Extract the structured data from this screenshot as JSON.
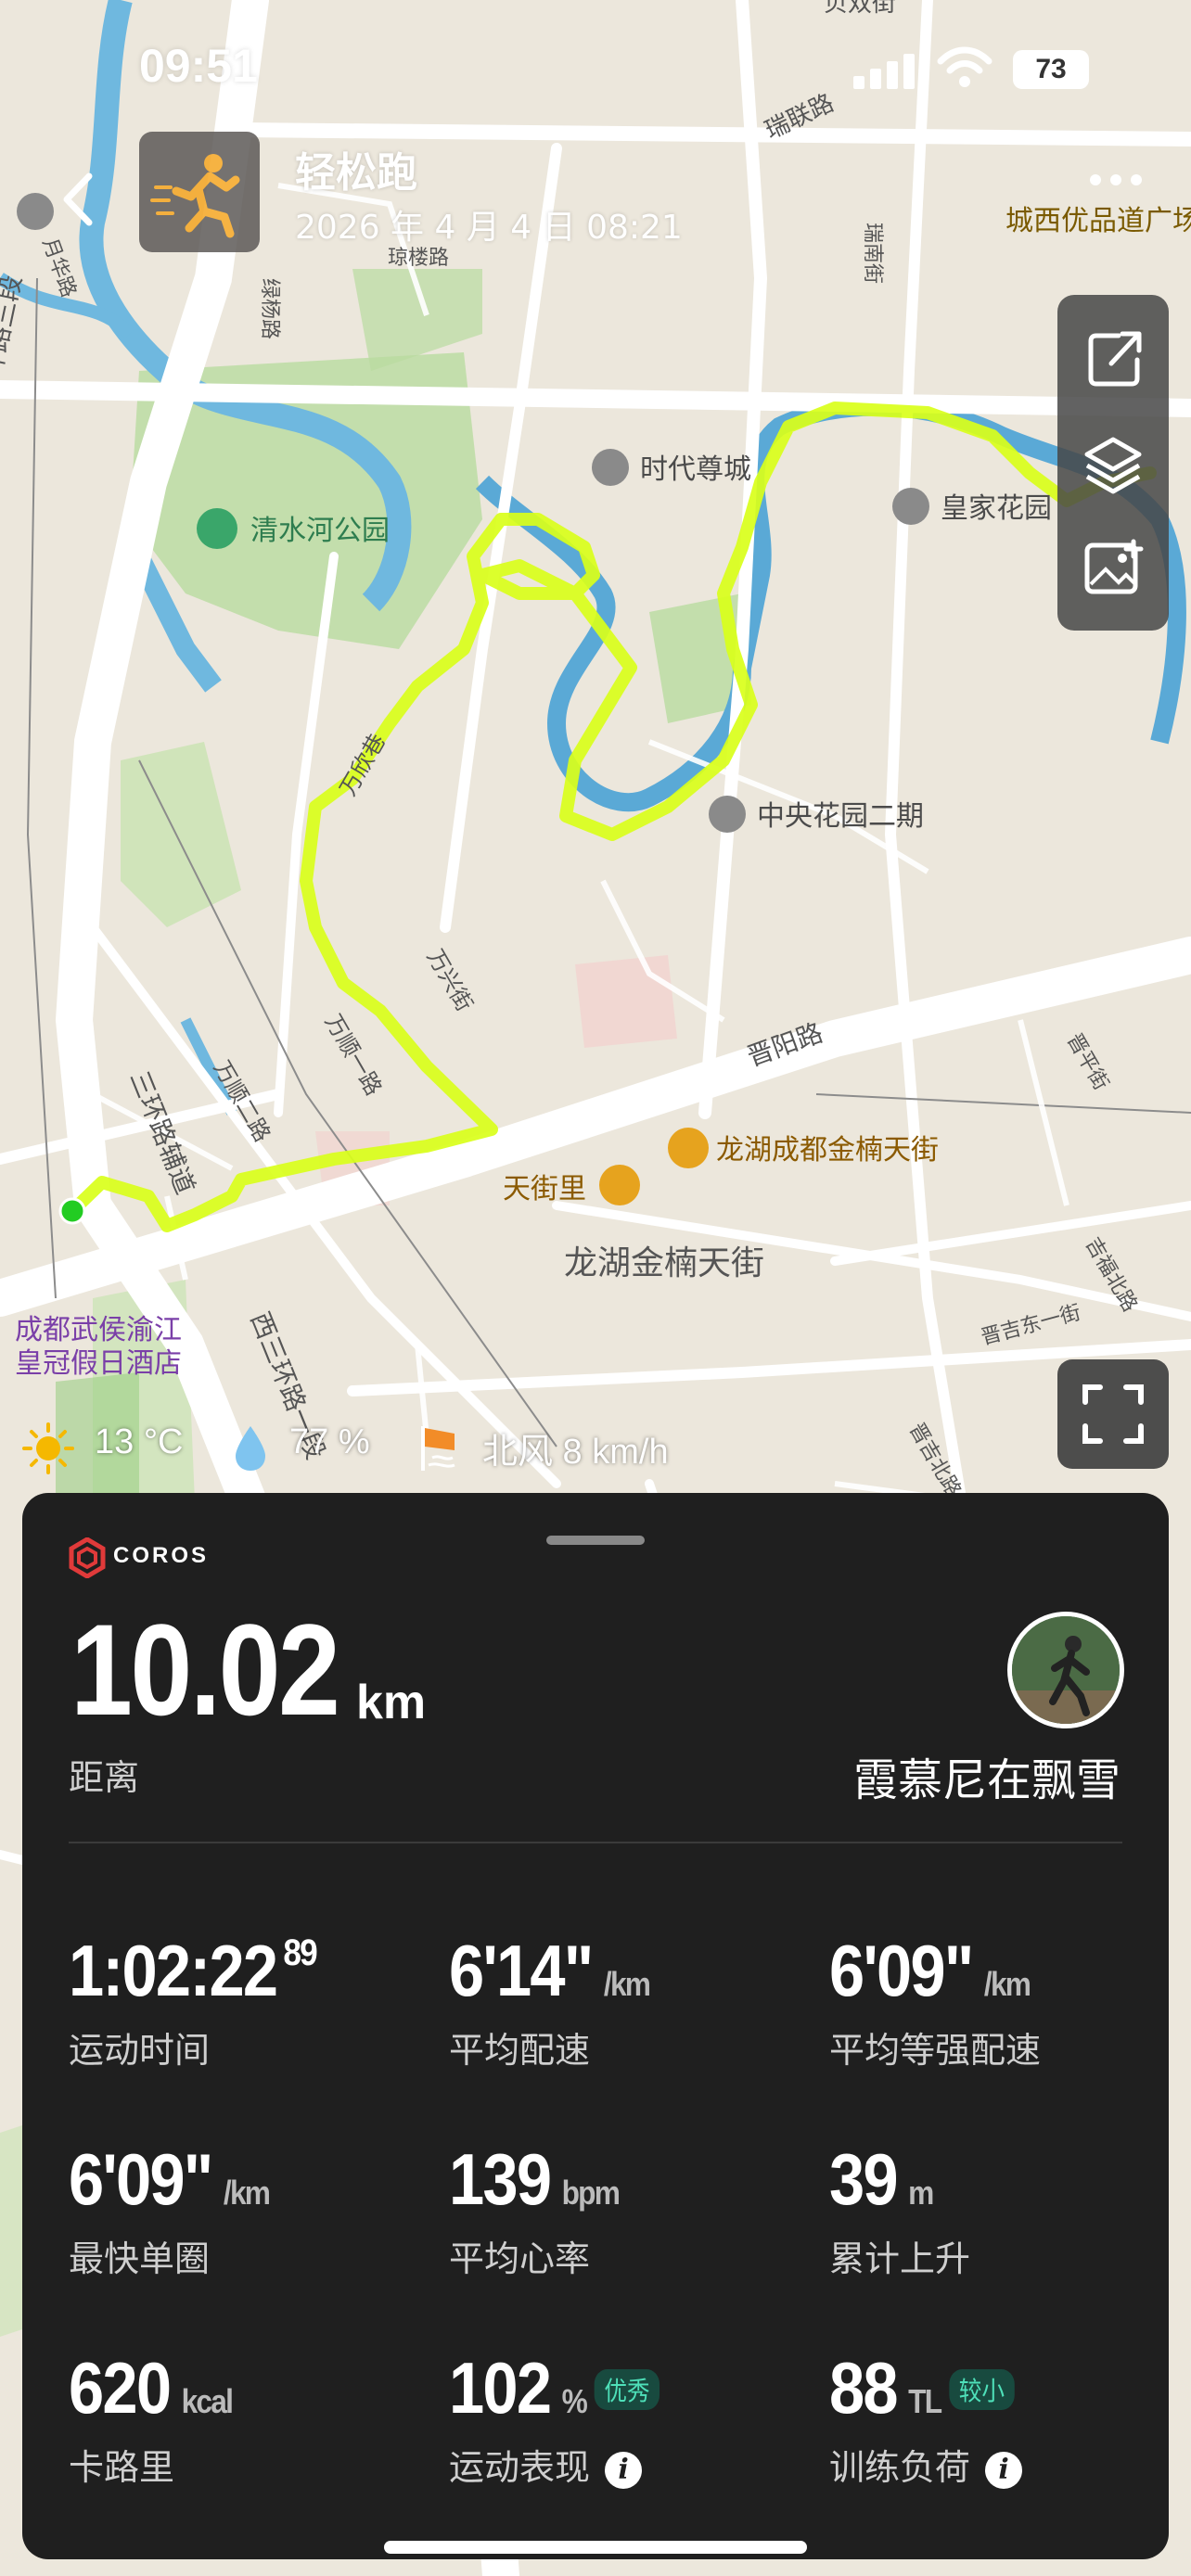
{
  "status_bar": {
    "time": "09:51",
    "battery": "73"
  },
  "header": {
    "title": "轻松跑",
    "date": "2026 年 4 月 4 日 08:21"
  },
  "map_labels": {
    "roads": [
      "瑞联路",
      "西三环路三段",
      "三环路辅道",
      "西三环路一段",
      "晋阳路",
      "万顺一路",
      "万顺二路",
      "万欣巷",
      "万兴街",
      "晋吉东一街",
      "吉福北路",
      "晋吉北路",
      "晋平街",
      "琼楼路",
      "绿杨路",
      "瑞南街",
      "月华路",
      "三环路辅道",
      "交",
      "武侯",
      "贝双街"
    ],
    "pois": [
      "清水河公园",
      "时代尊城",
      "皇家花园",
      "中央花园二期",
      "龙湖成都金楠天街",
      "天街里",
      "龙湖金楠天街",
      "成都武侯渝江皇冠假日酒店",
      "城西优品道广场"
    ]
  },
  "weather": {
    "temperature": "13 °C",
    "humidity": "77 %",
    "wind": "北风 8 km/h"
  },
  "summary": {
    "brand": "COROS",
    "distance_value": "10.02",
    "distance_unit": "km",
    "distance_label": "距离",
    "username": "霞慕尼在飘雪"
  },
  "stats": [
    {
      "value": "1:02:22",
      "sup": "89",
      "unit": "",
      "label": "运动时间"
    },
    {
      "value": "6'14\"",
      "unit": "/km",
      "label": "平均配速"
    },
    {
      "value": "6'09\"",
      "unit": "/km",
      "label": "平均等强配速"
    },
    {
      "value": "6'09\"",
      "unit": "/km",
      "label": "最快单圈"
    },
    {
      "value": "139",
      "unit": "bpm",
      "label": "平均心率"
    },
    {
      "value": "39",
      "unit": "m",
      "label": "累计上升"
    },
    {
      "value": "620",
      "unit": "kcal",
      "label": "卡路里"
    },
    {
      "value": "102",
      "unit": "%",
      "badge": "优秀",
      "label": "运动表现"
    },
    {
      "value": "88",
      "unit": "TL",
      "badge": "较小",
      "label": "训练负荷"
    }
  ],
  "colors": {
    "route": "#d9ff1a",
    "river": "#5aa9d6",
    "panel": "#1f1f1f",
    "badge_text": "#4ee0b9",
    "start_dot": "#22cc22"
  }
}
